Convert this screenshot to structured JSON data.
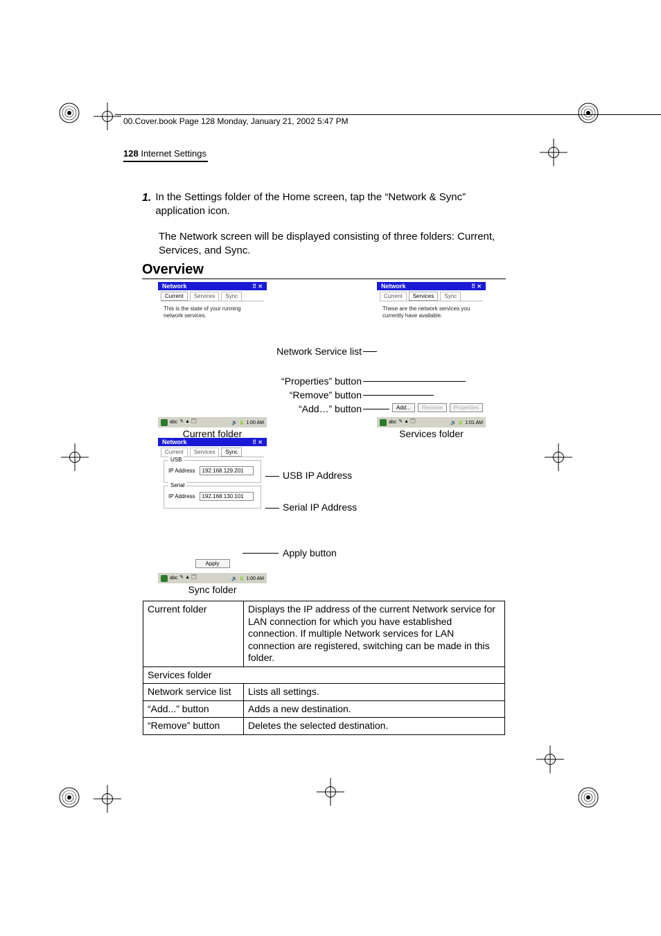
{
  "header_line": "00.Cover.book  Page 128  Monday, January 21, 2002  5:47 PM",
  "chapter": {
    "page_number": "128",
    "title": "Internet Settings"
  },
  "step": {
    "number": "1.",
    "text": "In the Settings folder of the Home screen, tap the “Network & Sync” application icon.",
    "result": "The Network screen will be displayed consisting of three folders: Current, Services, and Sync."
  },
  "overview_heading": "Overview",
  "screenshots": {
    "common": {
      "window_title": "Network",
      "tabs": {
        "current": "Current",
        "services": "Services",
        "sync": "Sync"
      },
      "taskbar_time_1": "1:00 AM",
      "taskbar_time_2": "1:01 AM",
      "taskbar_text": "abc"
    },
    "current": {
      "blurb": "This is the state of your running network services.",
      "caption": "Current folder"
    },
    "services": {
      "blurb": "These are the network services you currently have available.",
      "buttons": {
        "add": "Add...",
        "remove": "Remove",
        "properties": "Properties"
      },
      "caption": "Services folder"
    },
    "sync": {
      "usb_legend": "USB",
      "serial_legend": "Serial",
      "ip_label": "IP Address",
      "ip_usb": "192.168.129.201",
      "ip_serial": "192.168.130.101",
      "apply": "Apply",
      "caption": "Sync folder"
    },
    "labels": {
      "network_service_list": "Network Service list",
      "properties_button": "“Properties” button",
      "remove_button": "“Remove” button",
      "add_button": "“Add…” button",
      "usb_ip": "USB IP Address",
      "serial_ip": "Serial IP Address",
      "apply_button": "Apply button"
    }
  },
  "table": {
    "r1": {
      "c1": "Current folder",
      "c2": "Displays the IP address of the current Network service for LAN connection for which you have established connection. If multiple Network services for LAN connection are registered, switching can be made in this folder."
    },
    "r2": {
      "c1": "Services folder",
      "c2": ""
    },
    "r3": {
      "c1": "Network service list",
      "c2": "Lists all settings."
    },
    "r4": {
      "c1": "“Add...” button",
      "c2": "Adds a new destination."
    },
    "r5": {
      "c1": "“Remove” button",
      "c2": "Deletes the selected destination."
    }
  }
}
